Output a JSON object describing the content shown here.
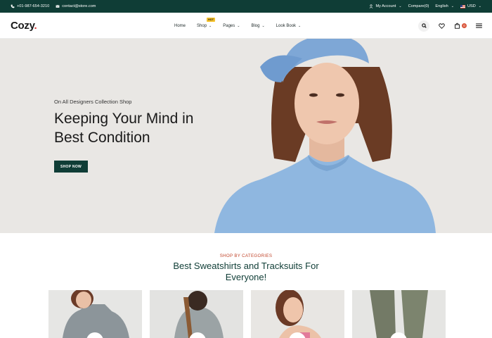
{
  "topbar": {
    "phone": "+01-987-654-3210",
    "email": "contact@store.com",
    "account": "My Account",
    "compare": "Compare(0)",
    "language": "English",
    "currency": "USD"
  },
  "header": {
    "logo": "Cozy",
    "logo_dot": ".",
    "nav": [
      {
        "label": "Home"
      },
      {
        "label": "Shop",
        "badge": "HOT"
      },
      {
        "label": "Pages"
      },
      {
        "label": "Blog"
      },
      {
        "label": "Look Book"
      }
    ],
    "cart_count": "0"
  },
  "hero": {
    "pretitle": "On All Designers Collection Shop",
    "title": "Keeping Your Mind in Best Condition",
    "button": "SHOP NOW"
  },
  "categories": {
    "pretitle": "SHOP BY CATEGORIES",
    "title": "Best Sweatshirts and Tracksuits For Everyone!"
  },
  "colors": {
    "brand_dark": "#0f3d36",
    "accent": "#c0442a",
    "hot_badge": "#f4c12a"
  }
}
